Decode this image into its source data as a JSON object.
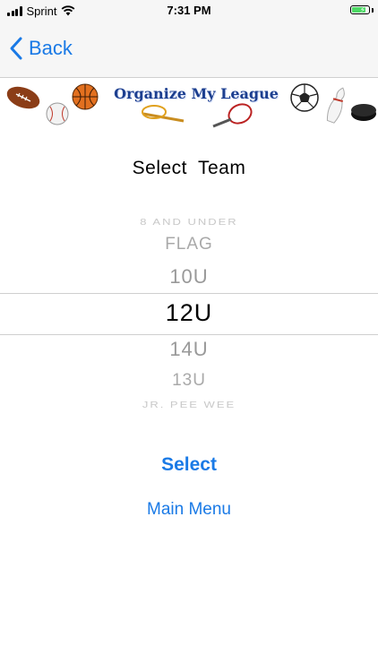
{
  "status_bar": {
    "carrier": "Sprint",
    "time": "7:31 PM"
  },
  "nav": {
    "back_label": "Back"
  },
  "banner": {
    "title": "Organize My League"
  },
  "screen": {
    "title": "Select  Team"
  },
  "picker": {
    "items": [
      "8 AND UNDER",
      "FLAG",
      "10U",
      "12U",
      "14U",
      "13U",
      "JR. PEE WEE"
    ],
    "selected": "12U"
  },
  "actions": {
    "select_label": "Select",
    "main_menu_label": "Main Menu"
  },
  "colors": {
    "accent": "#1a7ae6",
    "battery": "#4cd964",
    "banner_text": "#1d3f8f"
  }
}
